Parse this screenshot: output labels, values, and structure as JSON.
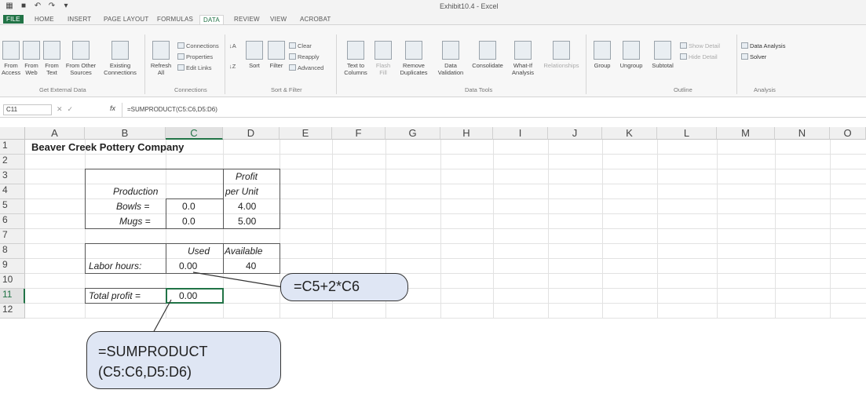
{
  "window": {
    "title": "Exhibit10.4 - Excel"
  },
  "ribbon": {
    "tabs": [
      "FILE",
      "HOME",
      "INSERT",
      "PAGE LAYOUT",
      "FORMULAS",
      "DATA",
      "REVIEW",
      "VIEW",
      "ACROBAT"
    ],
    "buttons": {
      "from_access": "From Access",
      "from_web": "From Web",
      "from_text": "From Text",
      "from_other": "From Other Sources",
      "existing": "Existing Connections",
      "refresh": "Refresh All",
      "sort": "Sort",
      "filter": "Filter",
      "text_to_columns": "Text to Columns",
      "flash_fill": "Flash Fill",
      "remove_duplicates": "Remove Duplicates",
      "data_validation": "Data Validation",
      "consolidate": "Consolidate",
      "what_if": "What-If Analysis",
      "relationships": "Relationships",
      "group": "Group",
      "ungroup": "Ungroup",
      "subtotal": "Subtotal"
    },
    "small": {
      "connections": "Connections",
      "properties": "Properties",
      "edit_links": "Edit Links",
      "clear": "Clear",
      "reapply": "Reapply",
      "advanced": "Advanced",
      "show_detail": "Show Detail",
      "hide_detail": "Hide Detail",
      "data_analysis": "Data Analysis",
      "solver": "Solver"
    },
    "groups": {
      "get_external": "Get External Data",
      "connections": "Connections",
      "sort_filter": "Sort & Filter",
      "data_tools": "Data Tools",
      "outline": "Outline",
      "analysis": "Analysis"
    }
  },
  "formula_bar": {
    "name_box": "C11",
    "fx": "fx",
    "formula": "=SUMPRODUCT(C5:C6,D5:D6)"
  },
  "sheet": {
    "columns": [
      "A",
      "B",
      "C",
      "D",
      "E",
      "F",
      "G",
      "H",
      "I",
      "J",
      "K",
      "L",
      "M",
      "N",
      "O"
    ],
    "rows": [
      "1",
      "2",
      "3",
      "4",
      "5",
      "6",
      "7",
      "8",
      "9",
      "10",
      "11",
      "12"
    ],
    "selected_column": "C",
    "selected_row": "11",
    "cells": {
      "a1": "Beaver Creek Pottery Company",
      "d3": "Profit",
      "b4": "Production",
      "d4": "per Unit",
      "b5": "Bowls =",
      "c5": "0.0",
      "d5": "4.00",
      "b6": "Mugs =",
      "c6": "0.0",
      "d6": "5.00",
      "c8": "Used",
      "d8": "Available",
      "b9": "Labor hours:",
      "c9": "0.00",
      "d9": "40",
      "b11": "Total profit =",
      "c11": "0.00"
    }
  },
  "callouts": {
    "labor_formula": "=C5+2*C6",
    "profit_formula_line1": "=SUMPRODUCT",
    "profit_formula_line2": "(C5:C6,D5:D6)"
  }
}
